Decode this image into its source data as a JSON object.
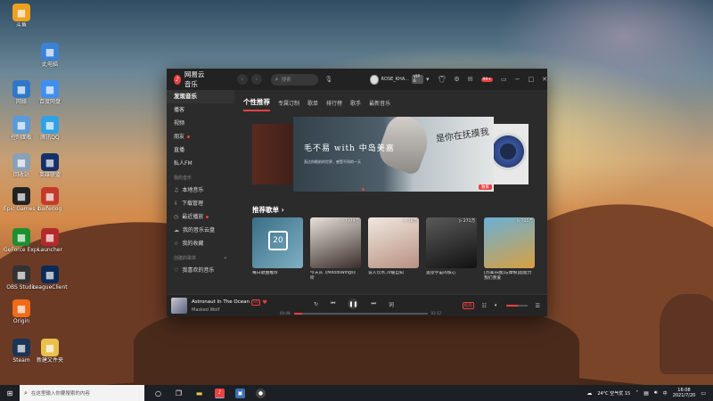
{
  "desktop": {
    "icons": [
      {
        "label": "斗鱼",
        "color": "#f0a020"
      },
      {
        "label": "此电脑",
        "color": "#3b82d6"
      },
      {
        "label": "网络",
        "color": "#2f78c9"
      },
      {
        "label": "控制面板",
        "color": "#5a9ad8"
      },
      {
        "label": "回收站",
        "color": "#8aa0b8"
      },
      {
        "label": "Epic Games Launcher",
        "color": "#222222"
      },
      {
        "label": "GeForce Experience",
        "color": "#1c8f2e"
      },
      {
        "label": "OBS Studio",
        "color": "#333333"
      },
      {
        "label": "Origin",
        "color": "#f06a1a"
      },
      {
        "label": "Steam",
        "color": "#1a3556"
      },
      {
        "label": "百度网盘",
        "color": "#3f8ff2"
      },
      {
        "label": "腾讯QQ",
        "color": "#2ea1e8"
      },
      {
        "label": "英雄联盟",
        "color": "#14306a"
      },
      {
        "label": "baiferlog",
        "color": "#c43a2a"
      },
      {
        "label": "Launcher",
        "color": "#b42a2a"
      },
      {
        "label": "LeagueClient",
        "color": "#0b2a55"
      },
      {
        "label": "新建文件夹",
        "color": "#e8c04a"
      }
    ]
  },
  "app": {
    "name": "网易云音乐",
    "search_placeholder": "搜索",
    "user_name": "ROSE_KHA...",
    "vip_label": "VIP 6",
    "msg_badge": "99+",
    "sidebar": {
      "items": [
        {
          "label": "发现音乐",
          "active": true
        },
        {
          "label": "播客"
        },
        {
          "label": "视频"
        },
        {
          "label": "朋友",
          "dot": true
        },
        {
          "label": "直播"
        },
        {
          "label": "私人FM"
        }
      ],
      "my_music_header": "我的音乐",
      "my_music": [
        {
          "label": "本地音乐",
          "icon": "♫"
        },
        {
          "label": "下载管理",
          "icon": "⇩"
        },
        {
          "label": "最近播放",
          "icon": "◷",
          "dot": true
        },
        {
          "label": "我的音乐云盘",
          "icon": "☁"
        },
        {
          "label": "我的收藏",
          "icon": "☆"
        }
      ],
      "created_header": "创建的歌单",
      "created_add": "+",
      "created": [
        {
          "label": "我喜欢的音乐",
          "icon": "♡"
        }
      ]
    },
    "tabs": [
      "个性推荐",
      "专属订制",
      "歌单",
      "排行榜",
      "歌手",
      "最新音乐"
    ],
    "banner": {
      "title_left": "毛不易 with 中岛美嘉",
      "title_right": "是你在抚摸我",
      "subtitle": "直达你眼前的世界，感受不同的一天",
      "tag": "独家"
    },
    "recommend_title": "推荐歌单 ›",
    "playlists": [
      {
        "title": "每日歌曲推荐",
        "count": "",
        "calendar_day": "20"
      },
      {
        "title": "今天从《Moodswings》听",
        "count": "▷ 7379万"
      },
      {
        "title": "说人饮水,冷暖自知",
        "count": "▷ 10万"
      },
      {
        "title": "遥望宇宙的核心",
        "count": "▷ 271万"
      },
      {
        "title": "[苏美乐曲]与摩根]超能力我们亲爱",
        "count": "▷ 725万"
      }
    ],
    "player": {
      "song": "Astronaut In The Ocean",
      "tag": "SQ",
      "artist": "Masked Wolf",
      "time_current": "00:08",
      "time_total": "02:12",
      "progress": 0.06,
      "volume": 0.55,
      "quality_label": "极高"
    }
  },
  "taskbar": {
    "search_placeholder": "在这里输入你要搜索的内容",
    "weather": "24°C 空气优 15",
    "ime": "中",
    "time": "16:08",
    "date": "2021/7/20"
  }
}
